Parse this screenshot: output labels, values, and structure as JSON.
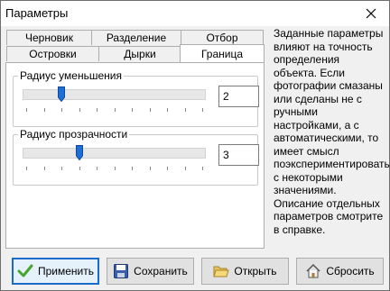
{
  "window": {
    "title": "Параметры"
  },
  "tabs": {
    "row_back": [
      "Черновик",
      "Разделение",
      "Отбор"
    ],
    "row_front": [
      "Островки",
      "Дырки",
      "Граница"
    ],
    "active": "Граница"
  },
  "groups": {
    "reduce": {
      "label": "Радиус уменьшения",
      "value": "2",
      "level": 0.2
    },
    "transparency": {
      "label": "Радиус прозрачности",
      "value": "3",
      "level": 0.3
    }
  },
  "help": {
    "text": "Заданные параметры влияют на точность определения объекта. Если фотографии смазаны или сделаны не с ручными настройками, а с автоматическими, то имеет смысл поэкспериментировать с некоторыми значениями. Описание отдельных параметров смотрите в справке."
  },
  "buttons": {
    "apply": "Применить",
    "save": "Сохранить",
    "open": "Открыть",
    "reset": "Сбросить"
  },
  "icons": [
    "close-icon",
    "checkmark-icon",
    "floppy-disk-icon",
    "open-folder-icon",
    "home-icon"
  ]
}
